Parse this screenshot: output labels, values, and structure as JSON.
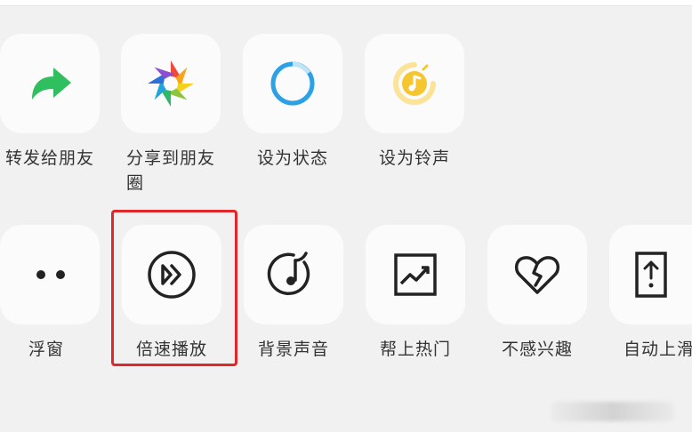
{
  "row1": [
    {
      "label": "转发给朋友",
      "icon": "share-arrow-icon"
    },
    {
      "label": "分享到朋友圈",
      "icon": "moments-shutter-icon"
    },
    {
      "label": "设为状态",
      "icon": "status-ring-icon"
    },
    {
      "label": "设为铃声",
      "icon": "ringtone-icon"
    }
  ],
  "row2": [
    {
      "label": "浮窗",
      "icon": "float-window-dots-icon"
    },
    {
      "label": "倍速播放",
      "icon": "speed-play-icon"
    },
    {
      "label": "背景声音",
      "icon": "background-sound-icon"
    },
    {
      "label": "帮上热门",
      "icon": "trending-chart-icon"
    },
    {
      "label": "不感兴趣",
      "icon": "broken-heart-icon"
    },
    {
      "label": "自动上滑",
      "icon": "auto-scroll-up-icon"
    }
  ],
  "colors": {
    "highlight_border": "#e0282a",
    "share_green": "#2fbf5f",
    "status_blue": "#2ea1e6",
    "ringtone_yellow": "#f5c630"
  }
}
